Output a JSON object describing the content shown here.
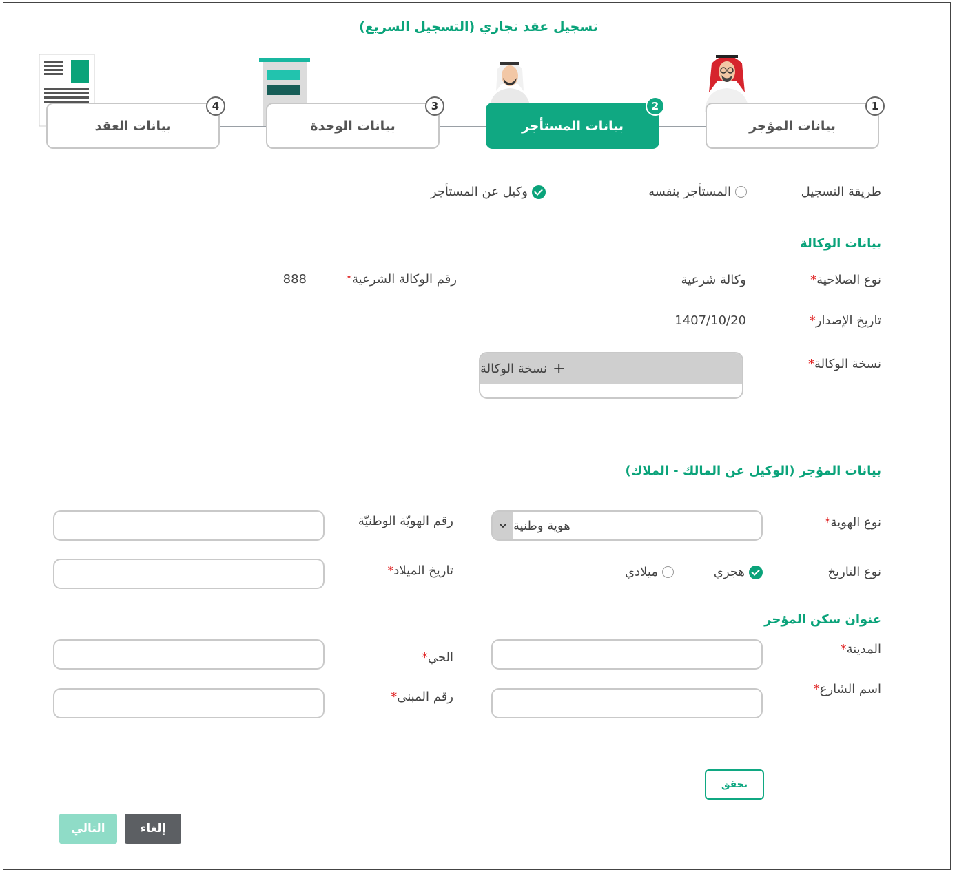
{
  "page_title": "تسجيل عقد تجاري (التسجيل السريع)",
  "steps": [
    {
      "number": "1",
      "label": "بيانات المؤجر"
    },
    {
      "number": "2",
      "label": "بيانات المستأجر"
    },
    {
      "number": "3",
      "label": "بيانات الوحدة"
    },
    {
      "number": "4",
      "label": "بيانات العقد"
    }
  ],
  "registration": {
    "label": "طريقة التسجيل",
    "option_self": "المستأجر بنفسه",
    "option_agent": "وكيل عن المستأجر",
    "selected": "option_agent"
  },
  "agency": {
    "section_title": "بيانات الوكالة",
    "authority_type_label": "نوع الصلاحية",
    "authority_type_value": "وكالة شرعية",
    "agency_number_label": "رقم الوكالة الشرعية",
    "agency_number_value": "888",
    "issue_date_label": "تاريخ الإصدار",
    "issue_date_value": "1407/10/20",
    "copy_label": "نسخة الوكالة",
    "upload_button": "نسخة الوكالة",
    "required_mark": "*"
  },
  "lessor": {
    "section_title": "بيانات المؤجر (الوكيل عن المالك - الملاك)",
    "id_type_label": "نوع الهوية",
    "id_type_value": "هوية وطنية",
    "national_id_label": "رقم الهويّة الوطنيّة",
    "national_id_value": "",
    "date_type_label": "نوع التاريخ",
    "date_hijri": "هجري",
    "date_gregorian": "ميلادي",
    "date_selected": "hijri",
    "birth_date_label": "تاريخ الميلاد",
    "birth_date_value": ""
  },
  "address": {
    "section_title": "عنوان سكن المؤجر",
    "city_label": "المدينة",
    "district_label": "الحي",
    "street_label": "اسم الشارع",
    "building_label": "رقم المبنى",
    "city_value": "",
    "district_value": "",
    "street_value": "",
    "building_value": ""
  },
  "buttons": {
    "verify": "تحقق",
    "cancel": "إلغاء",
    "next": "التالي"
  },
  "colors": {
    "accent": "#10a882",
    "accent_light": "#8fdcc7",
    "required": "#e02424",
    "cancel_bg": "#5c5f63"
  },
  "icons": [
    "lessor-avatar-icon",
    "tenant-avatar-icon",
    "unit-building-icon",
    "contract-document-icon",
    "plus-icon",
    "chevron-down-icon",
    "check-circle-icon",
    "radio-empty-icon"
  ]
}
